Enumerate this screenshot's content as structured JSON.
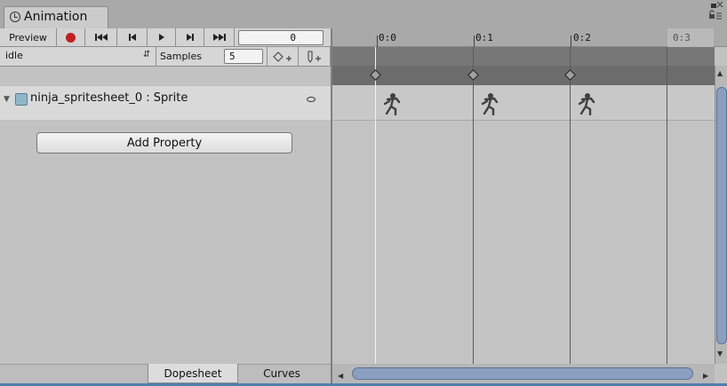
{
  "window": {
    "tab_title": "Animation"
  },
  "toolbar": {
    "preview_label": "Preview",
    "time_value": "0",
    "clip_value": "idle",
    "samples_label": "Samples",
    "samples_value": "5"
  },
  "property": {
    "name": "ninja_spritesheet_0 : Sprite"
  },
  "add_property_label": "Add Property",
  "bottom_tabs": {
    "dopesheet": "Dopesheet",
    "curves": "Curves"
  },
  "timeline": {
    "ticks": [
      "0:0",
      "0:1",
      "0:2",
      "0:3"
    ]
  },
  "colors": {
    "record": "#c41e1e",
    "scroll_thumb": "#8a9fc0",
    "accent": "#4f7fb0"
  },
  "icons": [
    "clock-icon",
    "record-icon",
    "first-key-icon",
    "prev-key-icon",
    "play-icon",
    "next-key-icon",
    "last-key-icon",
    "add-keyframe-icon",
    "add-event-icon",
    "dropdown-arrow-icon",
    "expand-arrow-icon",
    "sprite-icon",
    "keyframe-dot-icon",
    "lock-icon",
    "menu-icon",
    "ninja-sprite-icon"
  ]
}
